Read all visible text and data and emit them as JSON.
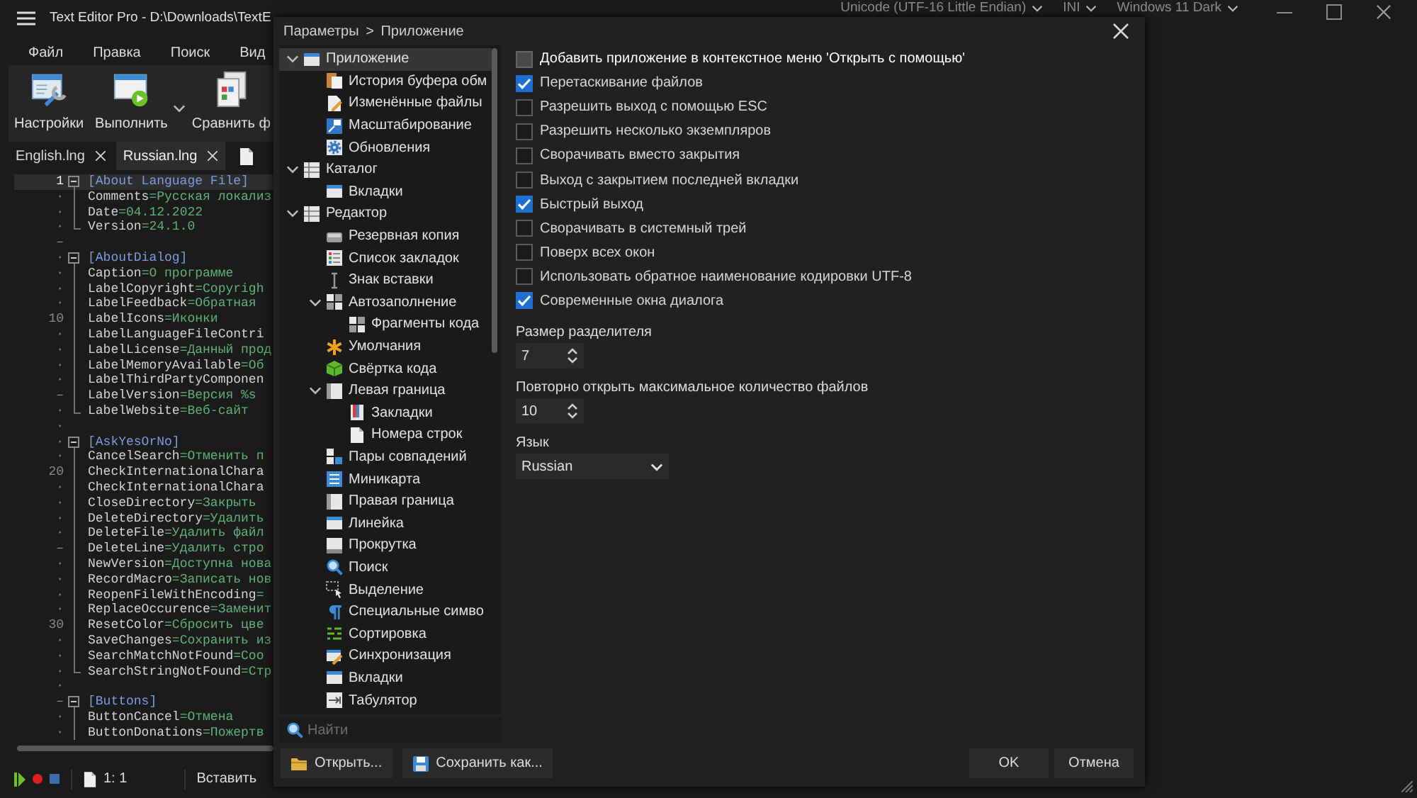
{
  "window": {
    "title": "Text Editor Pro - D:\\Downloads\\TextE",
    "selectors": [
      {
        "label": "Unicode (UTF-16 Little Endian)"
      },
      {
        "label": "INI"
      },
      {
        "label": "Windows 11 Dark"
      }
    ]
  },
  "menu": [
    {
      "label": "Файл"
    },
    {
      "label": "Правка"
    },
    {
      "label": "Поиск"
    },
    {
      "label": "Вид"
    }
  ],
  "ribbon": [
    {
      "label": "Настройки",
      "has_menu": false
    },
    {
      "label": "Выполнить",
      "has_menu": true
    },
    {
      "label": "Сравнить ф",
      "has_menu": false
    }
  ],
  "tabs": [
    {
      "label": "English.lng",
      "selected": false
    },
    {
      "label": "Russian.lng",
      "selected": true
    }
  ],
  "editor": {
    "lines": [
      {
        "gutter": "1",
        "kind": "section",
        "text": "[About Language File]",
        "current": true,
        "expanded": true,
        "children": [
          {
            "gutter": "·",
            "kind": "pair",
            "text": "Comments=Русская локализ",
            "current": false
          },
          {
            "gutter": "·",
            "kind": "pair",
            "text": "Date=04.12.2022",
            "current": false
          },
          {
            "gutter": "·",
            "kind": "pair",
            "text": "Version=24.1.0",
            "current": false
          }
        ]
      },
      {
        "gutter": "–",
        "kind": "blank",
        "current": false
      },
      {
        "gutter": "·",
        "kind": "section",
        "text": "[AboutDialog]",
        "current": false,
        "expanded": true,
        "children": [
          {
            "gutter": "·",
            "kind": "pair",
            "text": "Caption=О программе",
            "current": false
          },
          {
            "gutter": "·",
            "kind": "pair",
            "text": "LabelCopyright=Copyrigh",
            "current": false
          },
          {
            "gutter": "·",
            "kind": "pair",
            "text": "LabelFeedback=Обратная",
            "current": false
          },
          {
            "gutter": "10",
            "kind": "pair",
            "text": "LabelIcons=Иконки",
            "current": false
          },
          {
            "gutter": "·",
            "kind": "pair",
            "text": "LabelLanguageFileContri",
            "current": false
          },
          {
            "gutter": "·",
            "kind": "pair",
            "text": "LabelLicense=Данный прод",
            "current": false
          },
          {
            "gutter": "·",
            "kind": "pair",
            "text": "LabelMemoryAvailable=Об",
            "current": false
          },
          {
            "gutter": "·",
            "kind": "pair",
            "text": "LabelThirdPartyComponen",
            "current": false
          },
          {
            "gutter": "–",
            "kind": "pair",
            "text": "LabelVersion=Версия %s",
            "current": false
          },
          {
            "gutter": "·",
            "kind": "pair",
            "text": "LabelWebsite=Веб-сайт",
            "current": false
          }
        ]
      },
      {
        "gutter": "·",
        "kind": "blank",
        "current": false
      },
      {
        "gutter": "·",
        "kind": "section",
        "text": "[AskYesOrNo]",
        "current": false,
        "expanded": true,
        "children": [
          {
            "gutter": "·",
            "kind": "pair",
            "text": "CancelSearch=Отменить п",
            "current": false
          },
          {
            "gutter": "20",
            "kind": "pair",
            "text": "CheckInternationalChara",
            "current": false
          },
          {
            "gutter": "·",
            "kind": "pair",
            "text": "CheckInternationalChara",
            "current": false
          },
          {
            "gutter": "·",
            "kind": "pair",
            "text": "CloseDirectory=Закрыть",
            "current": false
          },
          {
            "gutter": "·",
            "kind": "pair",
            "text": "DeleteDirectory=Удалить",
            "current": false
          },
          {
            "gutter": "·",
            "kind": "pair",
            "text": "DeleteFile=Удалить файл",
            "current": false
          },
          {
            "gutter": "–",
            "kind": "pair",
            "text": "DeleteLine=Удалить стро",
            "current": false
          },
          {
            "gutter": "·",
            "kind": "pair",
            "text": "NewVersion=Доступна нова",
            "current": false
          },
          {
            "gutter": "·",
            "kind": "pair",
            "text": "RecordMacro=Записать нов",
            "current": false
          },
          {
            "gutter": "·",
            "kind": "pair",
            "text": "ReopenFileWithEncoding=",
            "current": false
          },
          {
            "gutter": "·",
            "kind": "pair",
            "text": "ReplaceOccurence=Заменит",
            "current": false
          },
          {
            "gutter": "30",
            "kind": "pair",
            "text": "ResetColor=Сбросить цве",
            "current": false
          },
          {
            "gutter": "·",
            "kind": "pair",
            "text": "SaveChanges=Сохранить из",
            "current": false
          },
          {
            "gutter": "·",
            "kind": "pair",
            "text": "SearchMatchNotFound=Соо",
            "current": false
          },
          {
            "gutter": "·",
            "kind": "pair",
            "text": "SearchStringNotFound=Стр",
            "current": false
          }
        ]
      },
      {
        "gutter": "·",
        "kind": "blank",
        "current": false
      },
      {
        "gutter": "–",
        "kind": "section",
        "text": "[Buttons]",
        "current": false,
        "expanded": true,
        "children": [
          {
            "gutter": "·",
            "kind": "pair",
            "text": "ButtonCancel=Отмена",
            "current": false
          },
          {
            "gutter": "·",
            "kind": "pair",
            "text": "ButtonDonations=Пожертв",
            "current": false
          }
        ]
      }
    ]
  },
  "status_bar": {
    "position": "1: 1",
    "mode": "Вставить"
  },
  "dialog": {
    "breadcrumb": "Параметры > Приложение",
    "tree": [
      {
        "label": "Приложение",
        "selected": true,
        "expanded": true,
        "children": [
          {
            "label": "История буфера обм",
            "selected": false
          },
          {
            "label": "Изменённые файлы",
            "selected": false
          },
          {
            "label": "Масштабирование",
            "selected": false
          },
          {
            "label": "Обновления",
            "selected": false
          }
        ]
      },
      {
        "label": "Каталог",
        "selected": false,
        "expanded": true,
        "children": [
          {
            "label": "Вкладки",
            "selected": false
          }
        ]
      },
      {
        "label": "Редактор",
        "selected": false,
        "expanded": true,
        "children": [
          {
            "label": "Резервная копия",
            "selected": false
          },
          {
            "label": "Список закладок",
            "selected": false
          },
          {
            "label": "Знак вставки",
            "selected": false
          },
          {
            "label": "Автозаполнение",
            "selected": false,
            "expanded": true,
            "children": [
              {
                "label": "Фрагменты кода",
                "selected": false
              }
            ]
          },
          {
            "label": "Умолчания",
            "selected": false
          },
          {
            "label": "Свёртка кода",
            "selected": false
          },
          {
            "label": "Левая граница",
            "selected": false,
            "expanded": true,
            "children": [
              {
                "label": "Закладки",
                "selected": false
              },
              {
                "label": "Номера строк",
                "selected": false
              }
            ]
          },
          {
            "label": "Пары совпадений",
            "selected": false
          },
          {
            "label": "Миникарта",
            "selected": false
          },
          {
            "label": "Правая граница",
            "selected": false
          },
          {
            "label": "Линейка",
            "selected": false
          },
          {
            "label": "Прокрутка",
            "selected": false
          },
          {
            "label": "Поиск",
            "selected": false
          },
          {
            "label": "Выделение",
            "selected": false
          },
          {
            "label": "Специальные симво",
            "selected": false
          },
          {
            "label": "Сортировка",
            "selected": false
          },
          {
            "label": "Синхронизация",
            "selected": false
          },
          {
            "label": "Вкладки",
            "selected": false
          },
          {
            "label": "Табулятор",
            "selected": false
          }
        ]
      }
    ],
    "search": {
      "placeholder": "Найти"
    },
    "options": [
      {
        "label": "Добавить приложение в контекстное меню 'Открыть с помощью'",
        "checked": false,
        "hovered": true
      },
      {
        "label": "Перетаскивание файлов",
        "checked": true,
        "hovered": false
      },
      {
        "label": "Разрешить выход с помощью ESC",
        "checked": false,
        "hovered": false
      },
      {
        "label": "Разрешить несколько экземпляров",
        "checked": false,
        "hovered": false
      },
      {
        "label": "Сворачивать вместо закрытия",
        "checked": false,
        "hovered": false
      },
      {
        "label": "Выход с закрытием последней вкладки",
        "checked": false,
        "hovered": false
      },
      {
        "label": "Быстрый выход",
        "checked": true,
        "hovered": false
      },
      {
        "label": "Сворачивать в системный трей",
        "checked": false,
        "hovered": false
      },
      {
        "label": "Поверх всех окон",
        "checked": false,
        "hovered": false
      },
      {
        "label": "Использовать обратное наименование кодировки UTF-8",
        "checked": false,
        "hovered": false
      },
      {
        "label": "Современные окна диалога",
        "checked": true,
        "hovered": false
      }
    ],
    "fields": [
      {
        "kind": "spin",
        "label": "Размер разделителя",
        "value": "7"
      },
      {
        "kind": "spin",
        "label": "Повторно открыть максимальное количество файлов",
        "value": "10"
      },
      {
        "kind": "select",
        "label": "Язык",
        "value": "Russian"
      }
    ],
    "buttons_left": [
      {
        "label": "Открыть...",
        "kind": "open"
      },
      {
        "label": "Сохранить как...",
        "kind": "save"
      }
    ],
    "buttons_right": [
      {
        "label": "OK"
      },
      {
        "label": "Отмена"
      }
    ]
  }
}
